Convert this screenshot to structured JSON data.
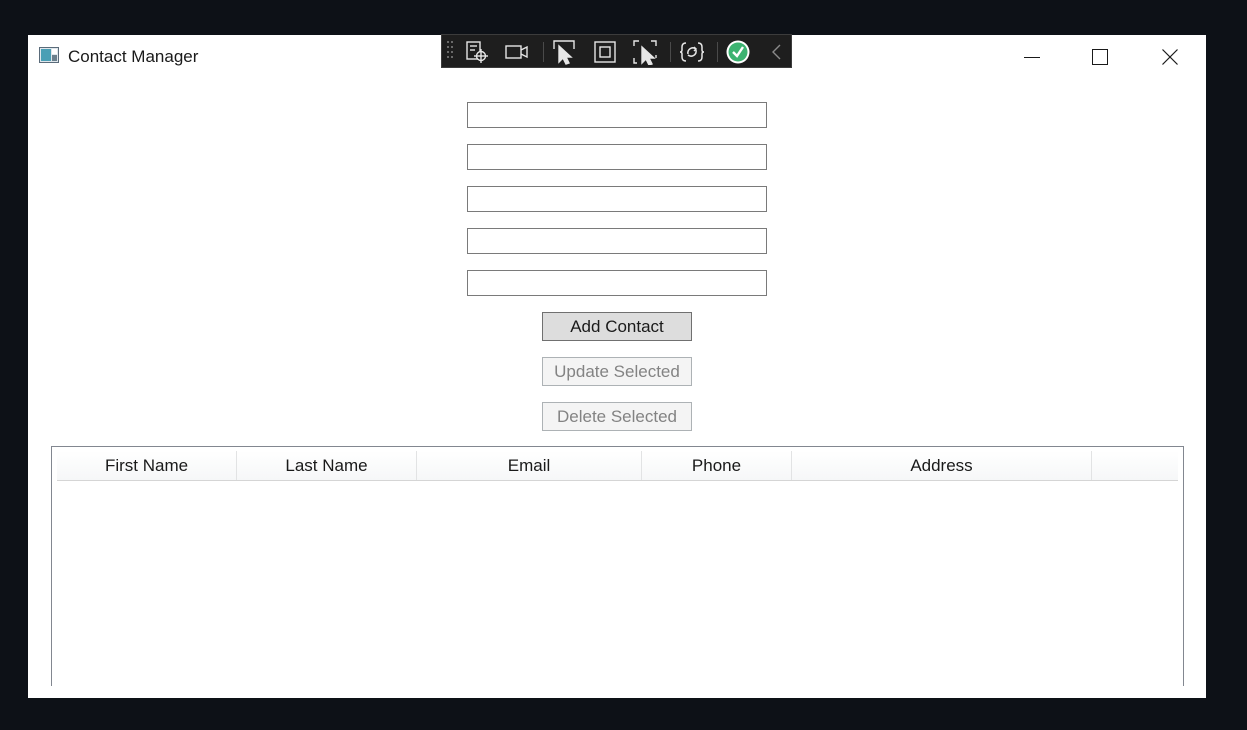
{
  "window": {
    "title": "Contact Manager"
  },
  "title_controls": {
    "minimize_icon": "minimize-icon",
    "maximize_icon": "maximize-icon",
    "close_icon": "close-icon"
  },
  "debug_toolbar": {
    "icons": [
      "select-element-icon",
      "video-icon",
      "pointer-select-icon",
      "layout-adorner-icon",
      "track-focus-icon",
      "hot-reload-icon",
      "check-circle-icon",
      "collapse-chevron-icon"
    ]
  },
  "form": {
    "fields": [
      {
        "value": "",
        "placeholder": ""
      },
      {
        "value": "",
        "placeholder": ""
      },
      {
        "value": "",
        "placeholder": ""
      },
      {
        "value": "",
        "placeholder": ""
      },
      {
        "value": "",
        "placeholder": ""
      }
    ],
    "add_label": "Add Contact",
    "update_label": "Update Selected",
    "delete_label": "Delete Selected"
  },
  "grid": {
    "columns": [
      "First Name",
      "Last Name",
      "Email",
      "Phone",
      "Address"
    ],
    "rows": []
  },
  "colors": {
    "desktop": "#0d1117",
    "window_bg": "#ffffff",
    "toolbar_bg": "#1e1e1e",
    "check_green": "#3cb371"
  }
}
